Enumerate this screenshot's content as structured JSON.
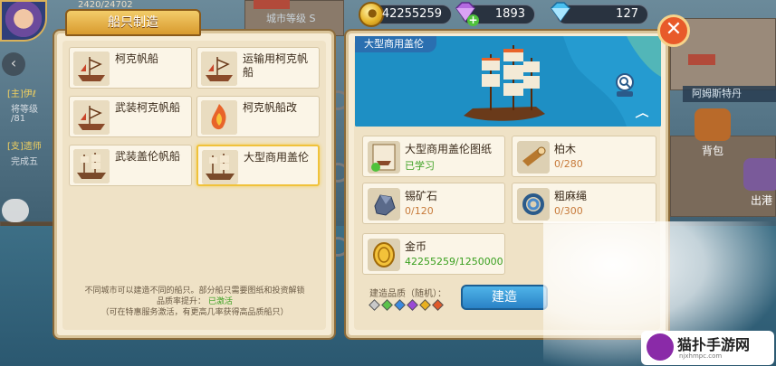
{
  "hud": {
    "level_text": "2420/24702",
    "city_level": "城市等级  S",
    "gold": "42255259",
    "gems": "1893",
    "diamonds": "127",
    "quests": [
      {
        "title": "[主]伊ℓ",
        "desc": "将等级",
        "sub": "/81"
      },
      {
        "title": "[支]遗师",
        "desc": "完成五",
        "sub": ""
      }
    ],
    "place_name": "阿姆斯特丹",
    "side_buttons": [
      "背包",
      "出港"
    ]
  },
  "left_panel": {
    "title": "船只制造",
    "ships": [
      {
        "name": "柯克帆船",
        "selected": false
      },
      {
        "name": "运输用柯克帆船",
        "selected": false
      },
      {
        "name": "武装柯克帆船",
        "selected": false
      },
      {
        "name": "柯克帆船改",
        "selected": false
      },
      {
        "name": "武装盖伦帆船",
        "selected": false
      },
      {
        "name": "大型商用盖伦",
        "selected": true
      }
    ],
    "info_line1": "不同城市可以建造不同的船只。部分船只需要图纸和投资解锁",
    "info_line2_prefix": "品质率提升：",
    "info_line2_status": "已激活",
    "info_line3": "（可在特惠服务激活，有更高几率获得高品质船只）"
  },
  "right_panel": {
    "ship_name": "大型商用盖伦",
    "materials": [
      {
        "name": "大型商用盖伦图纸",
        "count": "已学习",
        "ok": true,
        "icon": "blueprint-icon"
      },
      {
        "name": "柏木",
        "count": "0/280",
        "ok": false,
        "icon": "wood-log-icon"
      },
      {
        "name": "锡矿石",
        "count": "0/120",
        "ok": false,
        "icon": "tin-ore-icon"
      },
      {
        "name": "粗麻绳",
        "count": "0/300",
        "ok": false,
        "icon": "rope-icon"
      },
      {
        "name": "金币",
        "count": "42255259/1250000",
        "ok": true,
        "icon": "gold-coin-icon"
      }
    ],
    "quality_label": "建造品质（随机）：",
    "quality_colors": [
      "#c9c9c9",
      "#5bc24a",
      "#3a8ae0",
      "#9a4ad6",
      "#e8b020",
      "#e05a2a"
    ],
    "build_label": "建造"
  },
  "watermark": {
    "title": "猫扑手游网",
    "sub": "njxhmpc.com"
  }
}
